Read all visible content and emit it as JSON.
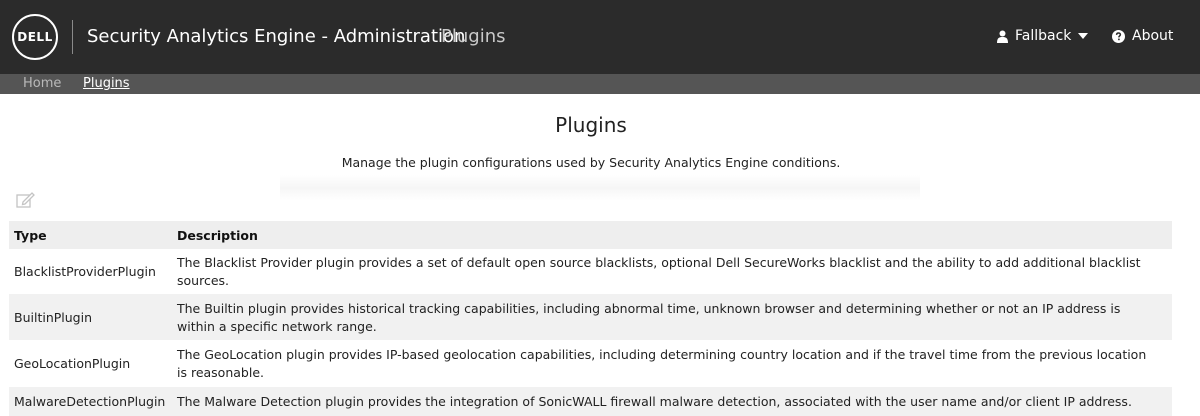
{
  "header": {
    "logo_text": "DELL",
    "app_title": "Security Analytics Engine - Administration",
    "section_title": "Plugins",
    "user_menu_label": "Fallback",
    "about_label": "About"
  },
  "breadcrumb": {
    "home_label": "Home",
    "current_label": "Plugins"
  },
  "page": {
    "title": "Plugins",
    "subtitle": "Manage the plugin configurations used by Security Analytics Engine conditions."
  },
  "table": {
    "headers": [
      "Type",
      "Description"
    ],
    "rows": [
      {
        "type": "BlacklistProviderPlugin",
        "description": "The Blacklist Provider plugin provides a set of default open source blacklists, optional Dell SecureWorks blacklist and the ability to add additional blacklist sources."
      },
      {
        "type": "BuiltinPlugin",
        "description": "The Builtin plugin provides historical tracking capabilities, including abnormal time, unknown browser and determining whether or not an IP address is within a specific network range."
      },
      {
        "type": "GeoLocationPlugin",
        "description": "The GeoLocation plugin provides IP-based geolocation capabilities, including determining country location and if the travel time from the previous location is reasonable."
      },
      {
        "type": "MalwareDetectionPlugin",
        "description": "The Malware Detection plugin provides the integration of SonicWALL firewall malware detection, associated with the user name and/or client IP address."
      }
    ]
  },
  "colors": {
    "header_bg": "#2b2b2b",
    "breadcrumb_bg": "#555555",
    "table_header_bg": "#eeeeee",
    "table_stripe_bg": "#f1f1f1"
  },
  "icons": [
    "dell-logo",
    "user-icon",
    "caret-down-icon",
    "question-circle-icon",
    "edit-icon"
  ]
}
